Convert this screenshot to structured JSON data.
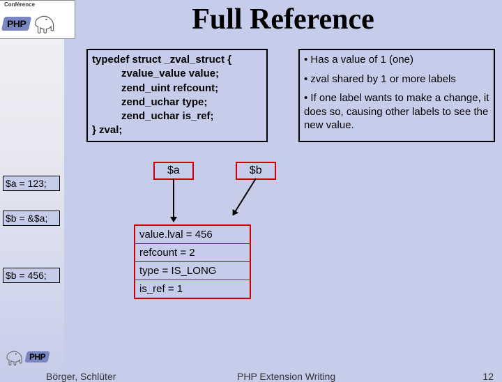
{
  "logo": {
    "conf": "Conférence",
    "php": "PHP"
  },
  "title": "Full Reference",
  "code": {
    "l1": "typedef struct _zval_struct {",
    "l2": "zvalue_value value;",
    "l3": "zend_uint refcount;",
    "l4": "zend_uchar type;",
    "l5": "zend_uchar is_ref;",
    "l6": "} zval;"
  },
  "notes": {
    "n1": "• Has a value of 1 (one)",
    "n2": "• zval shared by 1 or more labels",
    "n3": "• If one label wants to make a change, it does so, causing other labels to see the new value."
  },
  "stmts": {
    "s1": "$a = 123;",
    "s2": "$b = &$a;",
    "s3": "$b = 456;"
  },
  "vars": {
    "a": "$a",
    "b": "$b"
  },
  "zval": {
    "r1": "value.lval = 456",
    "r2": "refcount = 2",
    "r3": "type = IS_LONG",
    "r4": "is_ref = 1"
  },
  "footer": {
    "authors": "Börger, Schlüter",
    "mid": "PHP Extension Writing",
    "page": "12"
  }
}
